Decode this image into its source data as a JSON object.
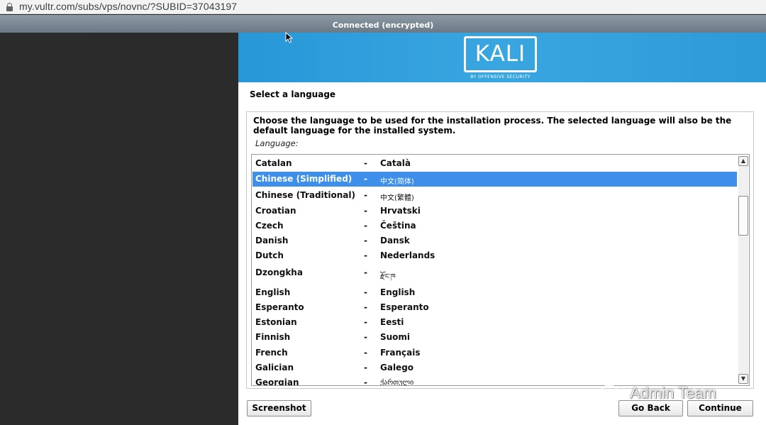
{
  "browser": {
    "url": "my.vultr.com/subs/vps/novnc/?SUBID=37043197"
  },
  "novnc": {
    "status": "Connected (encrypted)"
  },
  "installer": {
    "logo_text": "KALI",
    "logo_subtitle": "BY OFFENSIVE SECURITY",
    "section_title": "Select a language",
    "description": "Choose the language to be used for the installation process. The selected language will also be the default language for the installed system.",
    "language_label": "Language:",
    "languages": [
      {
        "name": "Catalan",
        "native": "Català",
        "selected": false
      },
      {
        "name": "Chinese (Simplified)",
        "native": "中文(简体)",
        "selected": true
      },
      {
        "name": "Chinese (Traditional)",
        "native": "中文(繁體)",
        "selected": false
      },
      {
        "name": "Croatian",
        "native": "Hrvatski",
        "selected": false
      },
      {
        "name": "Czech",
        "native": "Čeština",
        "selected": false
      },
      {
        "name": "Danish",
        "native": "Dansk",
        "selected": false
      },
      {
        "name": "Dutch",
        "native": "Nederlands",
        "selected": false
      },
      {
        "name": "Dzongkha",
        "native": "རྫོང་ཁ",
        "selected": false
      },
      {
        "name": "English",
        "native": "English",
        "selected": false
      },
      {
        "name": "Esperanto",
        "native": "Esperanto",
        "selected": false
      },
      {
        "name": "Estonian",
        "native": "Eesti",
        "selected": false
      },
      {
        "name": "Finnish",
        "native": "Suomi",
        "selected": false
      },
      {
        "name": "French",
        "native": "Français",
        "selected": false
      },
      {
        "name": "Galician",
        "native": "Galego",
        "selected": false
      },
      {
        "name": "Georgian",
        "native": "ქართული",
        "selected": false
      }
    ],
    "separator": "-",
    "buttons": {
      "screenshot": "Screenshot",
      "go_back": "Go Back",
      "continue": "Continue"
    }
  },
  "watermark": {
    "text": "Admin Team",
    "icon": "wechat-icon"
  },
  "colors": {
    "banner": "#2d9ad8",
    "selection": "#3d8fea"
  }
}
